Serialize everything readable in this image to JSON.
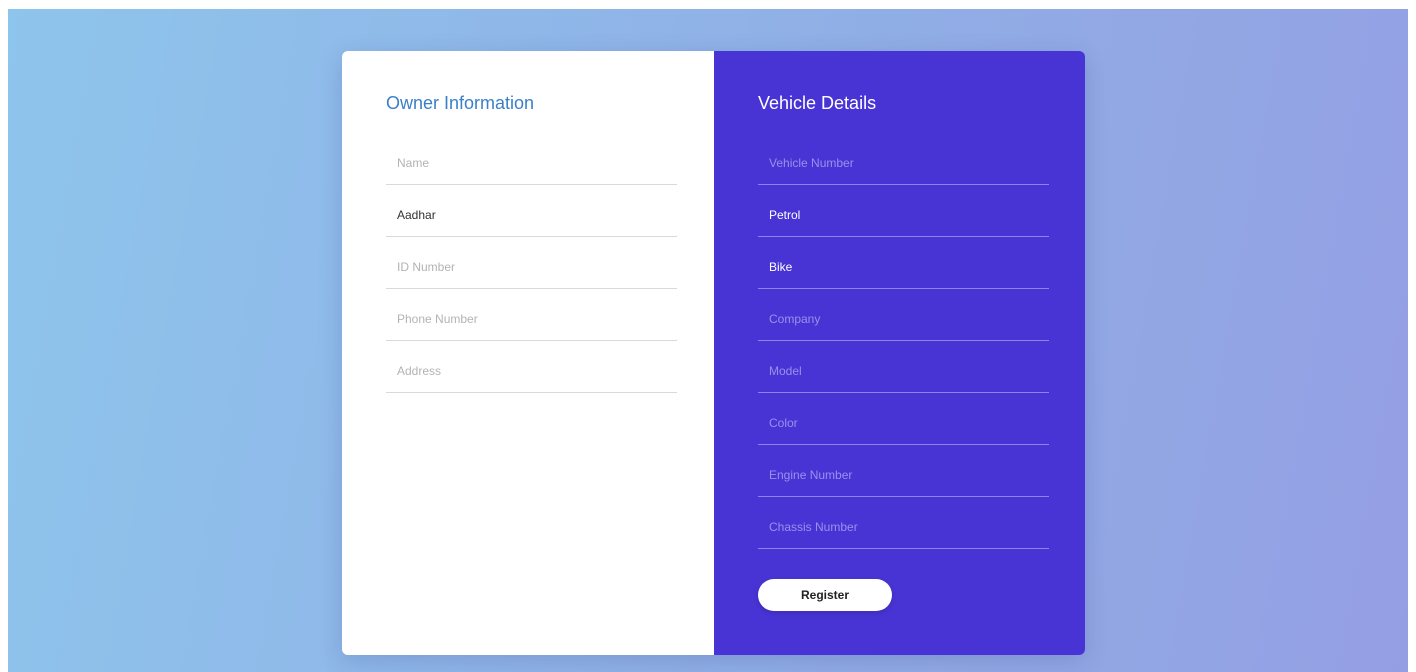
{
  "owner": {
    "title": "Owner Information",
    "fields": [
      {
        "placeholder": "Name",
        "value": ""
      },
      {
        "placeholder": "",
        "value": "Aadhar"
      },
      {
        "placeholder": "ID Number",
        "value": ""
      },
      {
        "placeholder": "Phone Number",
        "value": ""
      },
      {
        "placeholder": "Address",
        "value": ""
      }
    ]
  },
  "vehicle": {
    "title": "Vehicle Details",
    "fields": [
      {
        "placeholder": "Vehicle Number",
        "value": ""
      },
      {
        "placeholder": "",
        "value": "Petrol"
      },
      {
        "placeholder": "",
        "value": "Bike"
      },
      {
        "placeholder": "Company",
        "value": ""
      },
      {
        "placeholder": "Model",
        "value": ""
      },
      {
        "placeholder": "Color",
        "value": ""
      },
      {
        "placeholder": "Engine Number",
        "value": ""
      },
      {
        "placeholder": "Chassis Number",
        "value": ""
      }
    ],
    "register_label": "Register"
  },
  "colors": {
    "background_start": "#8ec5ec",
    "background_end": "#949fe3",
    "owner_title": "#3a7fc8",
    "vehicle_panel": "#4834d4",
    "button_bg": "#ffffff"
  }
}
